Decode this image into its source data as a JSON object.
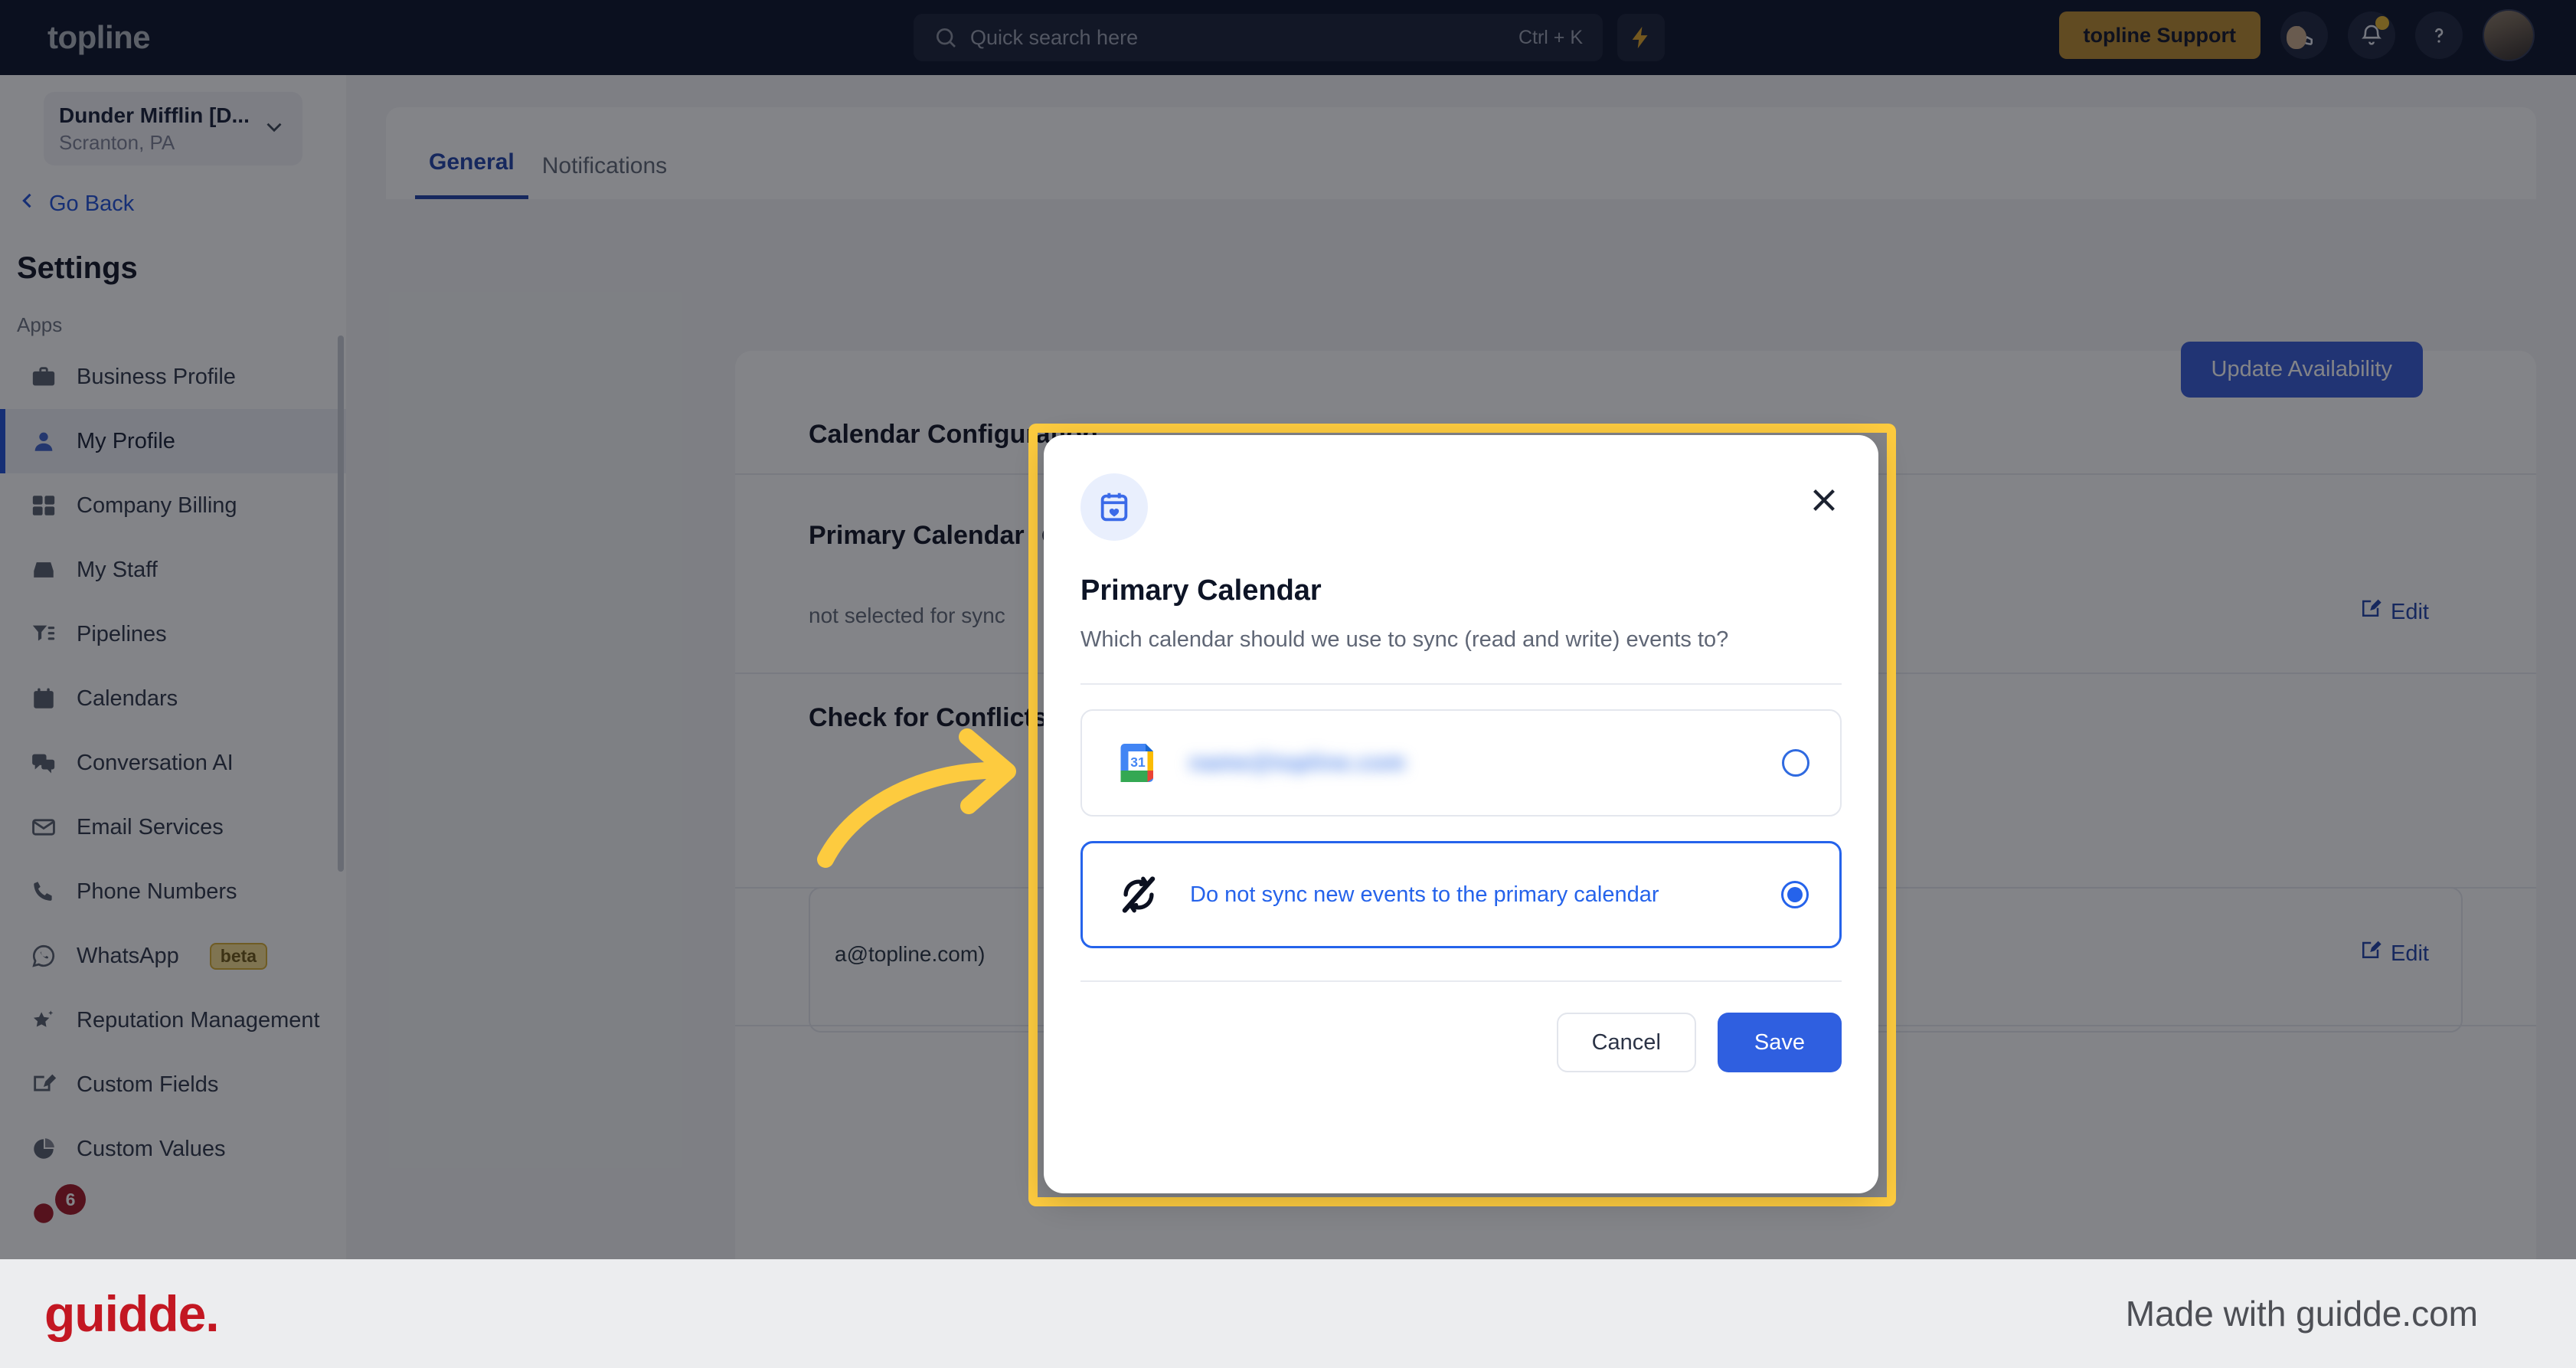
{
  "topbar": {
    "brand": "topline",
    "search": {
      "placeholder": "Quick search here",
      "shortcut": "Ctrl + K",
      "icon": "search-icon"
    },
    "bolt_icon": "lightning-bolt-icon",
    "support_label": "topline Support",
    "phone_icon": "phone-icon",
    "bell_icon": "bell-icon",
    "help_icon": "question-mark-icon",
    "avatar": "user-avatar"
  },
  "sidebar": {
    "org_name": "Dunder Mifflin [D...",
    "org_location": "Scranton, PA",
    "go_back": "Go Back",
    "title": "Settings",
    "group_label": "Apps",
    "items": [
      {
        "label": "Business Profile",
        "icon": "briefcase-icon",
        "active": false
      },
      {
        "label": "My Profile",
        "icon": "person-icon",
        "active": true
      },
      {
        "label": "Company Billing",
        "icon": "calculator-icon",
        "active": false
      },
      {
        "label": "My Staff",
        "icon": "inbox-icon",
        "active": false
      },
      {
        "label": "Pipelines",
        "icon": "filter-icon",
        "active": false
      },
      {
        "label": "Calendars",
        "icon": "calendar-icon",
        "active": false
      },
      {
        "label": "Conversation AI",
        "icon": "chat-bubbles-icon",
        "active": false
      },
      {
        "label": "Email Services",
        "icon": "envelope-icon",
        "active": false
      },
      {
        "label": "Phone Numbers",
        "icon": "phone-icon",
        "active": false
      },
      {
        "label": "WhatsApp",
        "icon": "whatsapp-icon",
        "badge": "beta",
        "active": false
      },
      {
        "label": "Reputation Management",
        "icon": "star-sparkle-icon",
        "active": false
      },
      {
        "label": "Custom Fields",
        "icon": "edit-box-icon",
        "active": false
      },
      {
        "label": "Custom Values",
        "icon": "pie-chart-icon",
        "active": false
      }
    ],
    "notification_count": "6"
  },
  "main": {
    "tabs": [
      {
        "label": "General",
        "selected": true
      },
      {
        "label": "Notifications",
        "selected": false
      }
    ],
    "update_availability_label": "Update Availability",
    "calendar_config_title": "Calendar Configuration",
    "primary_calendar_title": "Primary Calendar",
    "primary_calendar_status": "not selected for sync",
    "conflicts_title": "Check for Conflicts",
    "conflicts_value": "a@topline.com)",
    "edit_label": "Edit",
    "info_icon": "info-circle-icon",
    "edit_icon": "pencil-square-icon"
  },
  "modal": {
    "header_icon": "calendar-heart-icon",
    "close_icon": "close-x-icon",
    "title": "Primary Calendar",
    "description": "Which calendar should we use to sync (read and write) events to?",
    "options": [
      {
        "icon": "google-calendar-icon",
        "label": "",
        "label_redacted": "name@topline.com",
        "selected": false,
        "redacted": true
      },
      {
        "icon": "no-sync-icon",
        "label": "Do not sync new events to the primary calendar",
        "selected": true,
        "redacted": false
      }
    ],
    "cancel_label": "Cancel",
    "save_label": "Save"
  },
  "annotation": {
    "arrow": "curved-arrow-right",
    "highlight_color": "#fdcb3f"
  },
  "footer": {
    "logo": "guidde.",
    "made_with": "Made with guidde.com"
  },
  "colors": {
    "nav_bg": "#050d25",
    "accent_blue": "#2563eb",
    "support_gold": "#b8882a",
    "highlight_yellow": "#fdcb3f",
    "guidde_red": "#c31722"
  }
}
